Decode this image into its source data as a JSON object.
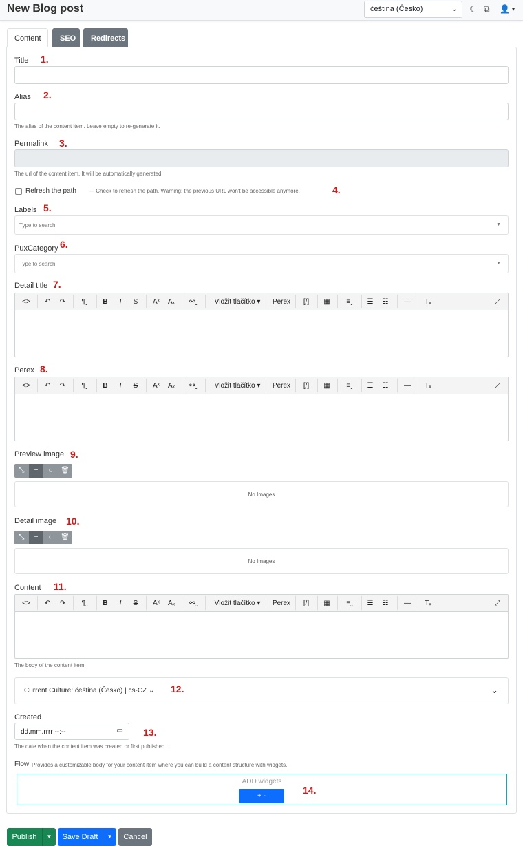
{
  "header": {
    "title": "New Blog post",
    "culture": "čeština (Česko)",
    "icons": [
      "moon-icon",
      "external-link-icon",
      "user-icon"
    ]
  },
  "tabs": [
    {
      "label": "Content",
      "active": true
    },
    {
      "label": "SEO",
      "active": false
    },
    {
      "label": "Redirects",
      "active": false
    }
  ],
  "fields": {
    "title": {
      "label": "Title",
      "value": ""
    },
    "alias": {
      "label": "Alias",
      "value": "",
      "help": "The alias of the content item. Leave empty to re-generate it."
    },
    "permalink": {
      "label": "Permalink",
      "value": "",
      "help": "The url of the content item. It will be automatically generated."
    },
    "refresh": {
      "label": "Refresh the path",
      "help": "— Check to refresh the path. Warning: the previous URL won't be accessible anymore.",
      "checked": false
    },
    "labels": {
      "label": "Labels",
      "placeholder": "Type to search"
    },
    "pux_category": {
      "label": "PuxCategory",
      "placeholder": "Type to search"
    },
    "detail_title": {
      "label": "Detail title"
    },
    "perex": {
      "label": "Perex"
    },
    "preview_image": {
      "label": "Preview image",
      "empty": "No Images"
    },
    "detail_image": {
      "label": "Detail image",
      "empty": "No Images"
    },
    "content": {
      "label": "Content",
      "help": "The body of the content item."
    },
    "culture_picker": {
      "label": "Current Culture: čeština (Česko) | cs-CZ"
    },
    "created": {
      "label": "Created",
      "value": "dd.mm.rrrr --:--",
      "help": "The date when the content item was created or first published."
    },
    "flow": {
      "label": "Flow",
      "help": "Provides a customizable body for your content item where you can build a content structure with widgets.",
      "add_text": "ADD widgets",
      "add_button": "+ -"
    }
  },
  "toolbar": {
    "insert_button": "Vložit tlačítko",
    "perex": "Perex",
    "shortcode": "[/]"
  },
  "annotations": [
    "1.",
    "2.",
    "3.",
    "4.",
    "5.",
    "6.",
    "7.",
    "8.",
    "9.",
    "10.",
    "11.",
    "12.",
    "13.",
    "14."
  ],
  "actions": {
    "publish": "Publish",
    "save_draft": "Save Draft",
    "cancel": "Cancel"
  },
  "colors": {
    "primary": "#0d6efd",
    "success": "#198754",
    "secondary": "#6c757d",
    "annotation": "#d11a1a",
    "flow_border": "#17a2b8"
  }
}
